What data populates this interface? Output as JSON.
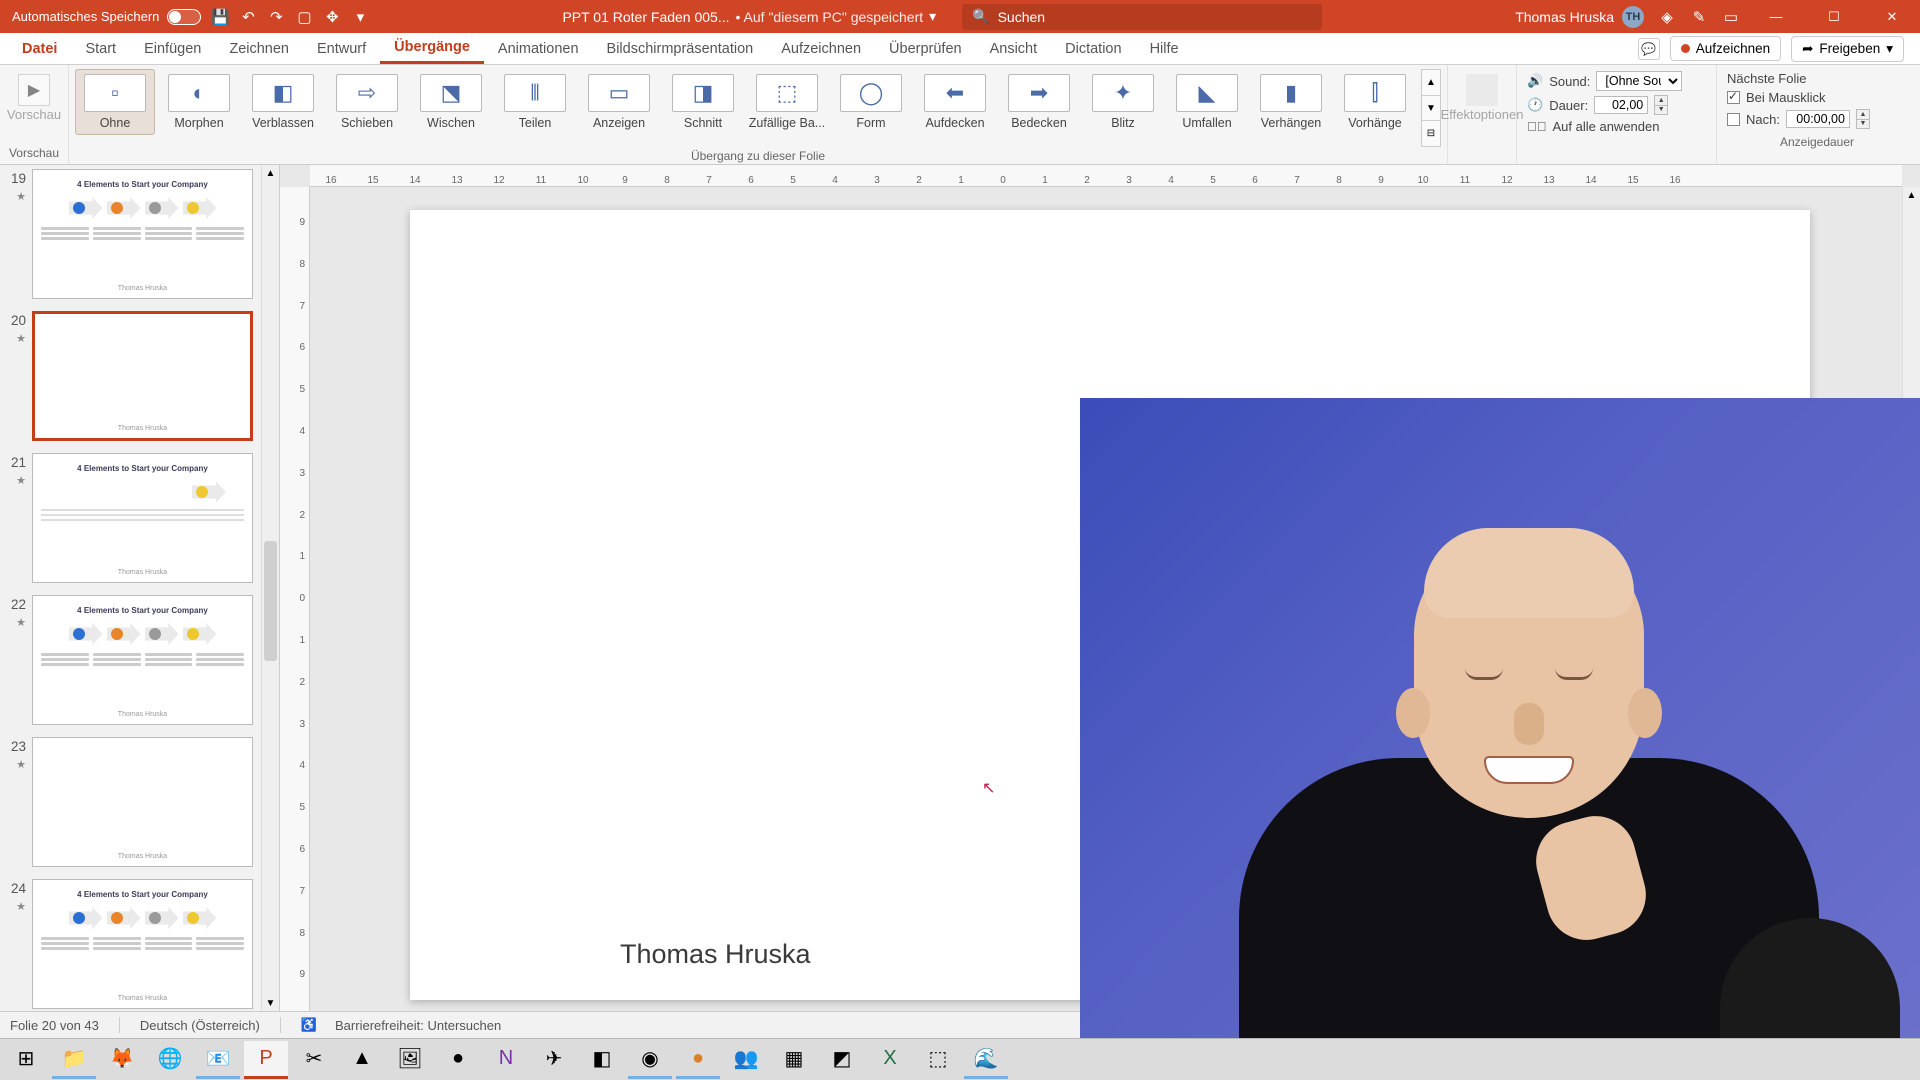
{
  "titlebar": {
    "auto_save": "Automatisches Speichern",
    "file_name": "PPT 01 Roter Faden 005...",
    "saved_hint": "• Auf \"diesem PC\" gespeichert",
    "search_placeholder": "Suchen",
    "user_name": "Thomas Hruska",
    "user_initials": "TH"
  },
  "tabs": {
    "file": "Datei",
    "items": [
      "Start",
      "Einfügen",
      "Zeichnen",
      "Entwurf",
      "Übergänge",
      "Animationen",
      "Bildschirmpräsentation",
      "Aufzeichnen",
      "Überprüfen",
      "Ansicht",
      "Dictation",
      "Hilfe"
    ],
    "active_index": 4,
    "record": "Aufzeichnen",
    "share": "Freigeben"
  },
  "ribbon": {
    "preview": "Vorschau",
    "transitions_label": "Übergang zu dieser Folie",
    "effect_options": "Effektoptionen",
    "transitions": [
      "Ohne",
      "Morphen",
      "Verblassen",
      "Schieben",
      "Wischen",
      "Teilen",
      "Anzeigen",
      "Schnitt",
      "Zufällige Ba...",
      "Form",
      "Aufdecken",
      "Bedecken",
      "Blitz",
      "Umfallen",
      "Verhängen",
      "Vorhänge"
    ],
    "selected_transition": 0,
    "timing": {
      "sound_label": "Sound:",
      "sound_value": "[Ohne Sound]",
      "duration_label": "Dauer:",
      "duration_value": "02,00",
      "apply_all": "Auf alle anwenden",
      "advance_header": "Nächste Folie",
      "on_click": "Bei Mausklick",
      "after_label": "Nach:",
      "after_value": "00:00,00",
      "group_label": "Anzeigedauer"
    }
  },
  "ruler": {
    "h": [
      "16",
      "15",
      "14",
      "13",
      "12",
      "11",
      "10",
      "9",
      "8",
      "7",
      "6",
      "5",
      "4",
      "3",
      "2",
      "1",
      "0",
      "1",
      "2",
      "3",
      "4",
      "5",
      "6",
      "7",
      "8",
      "9",
      "10",
      "11",
      "12",
      "13",
      "14",
      "15",
      "16"
    ],
    "v": [
      "9",
      "8",
      "7",
      "6",
      "5",
      "4",
      "3",
      "2",
      "1",
      "0",
      "1",
      "2",
      "3",
      "4",
      "5",
      "6",
      "7",
      "8",
      "9"
    ]
  },
  "thumbs": [
    {
      "num": "19",
      "title": "4 Elements to Start your Company",
      "type": "full",
      "foot": "Thomas Hruska"
    },
    {
      "num": "20",
      "title": "",
      "type": "blank",
      "selected": true,
      "foot": "Thomas Hruska"
    },
    {
      "num": "21",
      "title": "4 Elements to Start your Company",
      "type": "single",
      "foot": "Thomas Hruska"
    },
    {
      "num": "22",
      "title": "4 Elements to Start your Company",
      "type": "full",
      "foot": "Thomas Hruska"
    },
    {
      "num": "23",
      "title": "",
      "type": "blank",
      "foot": "Thomas Hruska"
    },
    {
      "num": "24",
      "title": "4 Elements to Start your Company",
      "type": "full",
      "foot": "Thomas Hruska"
    }
  ],
  "slide": {
    "author": "Thomas Hruska"
  },
  "status": {
    "slide_of": "Folie 20 von 43",
    "language": "Deutsch (Österreich)",
    "accessibility": "Barrierefreiheit: Untersuchen"
  },
  "taskbar_icons": [
    "start",
    "explorer",
    "firefox",
    "chrome",
    "outlook",
    "powerpoint",
    "snip",
    "vlc",
    "gallery",
    "todo",
    "onenote",
    "telegram",
    "app1",
    "obs",
    "obs2",
    "teams",
    "app2",
    "app3",
    "excel",
    "app4",
    "edge"
  ]
}
